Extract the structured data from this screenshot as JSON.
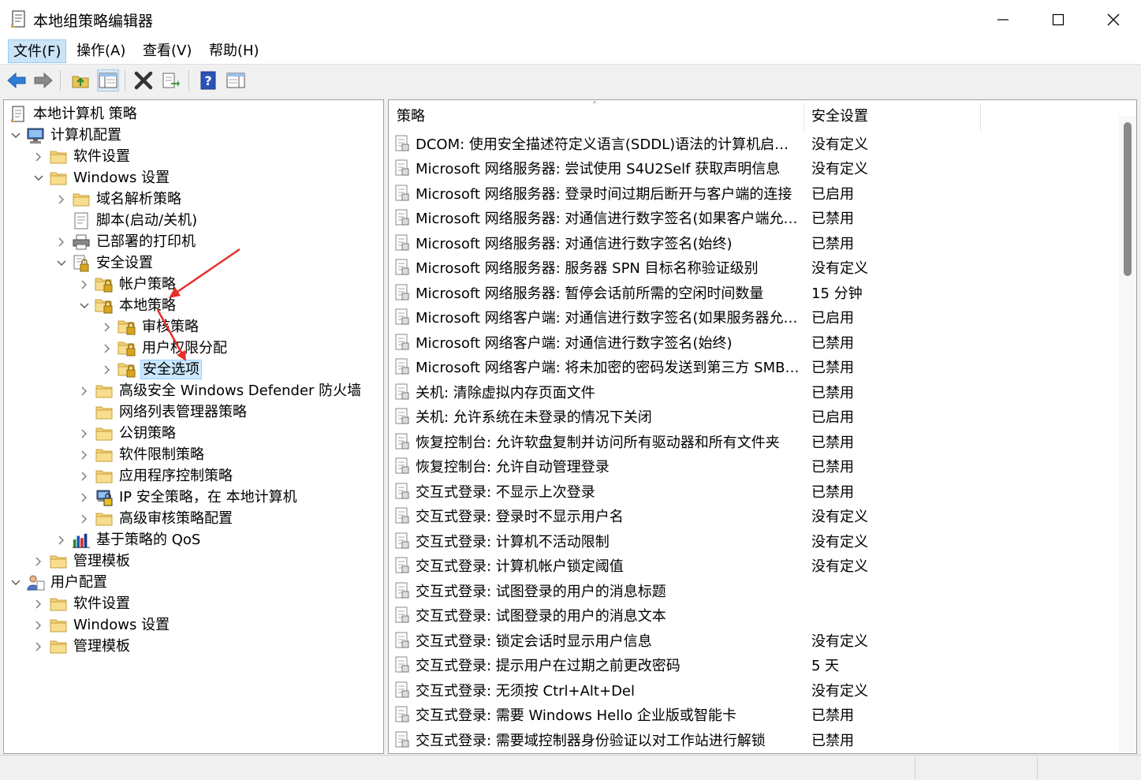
{
  "window": {
    "title": "本地组策略编辑器"
  },
  "menu": [
    {
      "label": "文件(F)",
      "active": true
    },
    {
      "label": "操作(A)",
      "active": false
    },
    {
      "label": "查看(V)",
      "active": false
    },
    {
      "label": "帮助(H)",
      "active": false
    }
  ],
  "tree": {
    "root": "本地计算机 策略",
    "items": [
      {
        "label": "计算机配置",
        "level": 1,
        "chev": "down",
        "icon": "computer-icon"
      },
      {
        "label": "软件设置",
        "level": 2,
        "chev": "right",
        "icon": "folder-icon"
      },
      {
        "label": "Windows 设置",
        "level": 2,
        "chev": "down",
        "icon": "folder-icon"
      },
      {
        "label": "域名解析策略",
        "level": 3,
        "chev": "right",
        "icon": "folder-icon"
      },
      {
        "label": "脚本(启动/关机)",
        "level": 3,
        "chev": "none",
        "icon": "script-icon"
      },
      {
        "label": "已部署的打印机",
        "level": 3,
        "chev": "right",
        "icon": "printer-icon"
      },
      {
        "label": "安全设置",
        "level": 3,
        "chev": "down",
        "icon": "security-settings-icon"
      },
      {
        "label": "帐户策略",
        "level": 4,
        "chev": "right",
        "icon": "secure-folder-icon"
      },
      {
        "label": "本地策略",
        "level": 4,
        "chev": "down",
        "icon": "secure-folder-icon"
      },
      {
        "label": "审核策略",
        "level": 5,
        "chev": "right",
        "icon": "secure-folder-icon"
      },
      {
        "label": "用户权限分配",
        "level": 5,
        "chev": "right",
        "icon": "secure-folder-icon"
      },
      {
        "label": "安全选项",
        "level": 5,
        "chev": "right",
        "icon": "secure-folder-icon",
        "selected": true
      },
      {
        "label": "高级安全 Windows Defender 防火墙",
        "level": 4,
        "chev": "right",
        "icon": "folder-icon"
      },
      {
        "label": "网络列表管理器策略",
        "level": 4,
        "chev": "none",
        "icon": "folder-icon"
      },
      {
        "label": "公钥策略",
        "level": 4,
        "chev": "right",
        "icon": "folder-icon"
      },
      {
        "label": "软件限制策略",
        "level": 4,
        "chev": "right",
        "icon": "folder-icon"
      },
      {
        "label": "应用程序控制策略",
        "level": 4,
        "chev": "right",
        "icon": "folder-icon"
      },
      {
        "label": "IP 安全策略，在 本地计算机",
        "level": 4,
        "chev": "right",
        "icon": "ip-security-icon"
      },
      {
        "label": "高级审核策略配置",
        "level": 4,
        "chev": "right",
        "icon": "folder-icon"
      },
      {
        "label": "基于策略的 QoS",
        "level": 3,
        "chev": "right",
        "icon": "qos-chart-icon"
      },
      {
        "label": "管理模板",
        "level": 2,
        "chev": "right",
        "icon": "folder-icon"
      },
      {
        "label": "用户配置",
        "level": 1,
        "chev": "down",
        "icon": "user-icon"
      },
      {
        "label": "软件设置",
        "level": 2,
        "chev": "right",
        "icon": "folder-icon"
      },
      {
        "label": "Windows 设置",
        "level": 2,
        "chev": "right",
        "icon": "folder-icon"
      },
      {
        "label": "管理模板",
        "level": 2,
        "chev": "right",
        "icon": "folder-icon"
      }
    ]
  },
  "list": {
    "columns": {
      "policy": "策略",
      "setting": "安全设置"
    },
    "rows": [
      {
        "name": "DCOM: 使用安全描述符定义语言(SDDL)语法的计算机启动...",
        "value": "没有定义"
      },
      {
        "name": "Microsoft 网络服务器: 尝试使用 S4U2Self 获取声明信息",
        "value": "没有定义"
      },
      {
        "name": "Microsoft 网络服务器: 登录时间过期后断开与客户端的连接",
        "value": "已启用"
      },
      {
        "name": "Microsoft 网络服务器: 对通信进行数字签名(如果客户端允许)",
        "value": "已禁用"
      },
      {
        "name": "Microsoft 网络服务器: 对通信进行数字签名(始终)",
        "value": "已禁用"
      },
      {
        "name": "Microsoft 网络服务器: 服务器 SPN 目标名称验证级别",
        "value": "没有定义"
      },
      {
        "name": "Microsoft 网络服务器: 暂停会话前所需的空闲时间数量",
        "value": "15 分钟"
      },
      {
        "name": "Microsoft 网络客户端: 对通信进行数字签名(如果服务器允许)",
        "value": "已启用"
      },
      {
        "name": "Microsoft 网络客户端: 对通信进行数字签名(始终)",
        "value": "已禁用"
      },
      {
        "name": "Microsoft 网络客户端: 将未加密的密码发送到第三方 SMB ...",
        "value": "已禁用"
      },
      {
        "name": "关机: 清除虚拟内存页面文件",
        "value": "已禁用"
      },
      {
        "name": "关机: 允许系统在未登录的情况下关闭",
        "value": "已启用"
      },
      {
        "name": "恢复控制台: 允许软盘复制并访问所有驱动器和所有文件夹",
        "value": "已禁用"
      },
      {
        "name": "恢复控制台: 允许自动管理登录",
        "value": "已禁用"
      },
      {
        "name": "交互式登录: 不显示上次登录",
        "value": "已禁用"
      },
      {
        "name": "交互式登录: 登录时不显示用户名",
        "value": "没有定义"
      },
      {
        "name": "交互式登录: 计算机不活动限制",
        "value": "没有定义"
      },
      {
        "name": "交互式登录: 计算机帐户锁定阈值",
        "value": "没有定义"
      },
      {
        "name": "交互式登录: 试图登录的用户的消息标题",
        "value": ""
      },
      {
        "name": "交互式登录: 试图登录的用户的消息文本",
        "value": ""
      },
      {
        "name": "交互式登录: 锁定会话时显示用户信息",
        "value": "没有定义"
      },
      {
        "name": "交互式登录: 提示用户在过期之前更改密码",
        "value": "5 天"
      },
      {
        "name": "交互式登录: 无须按 Ctrl+Alt+Del",
        "value": "没有定义"
      },
      {
        "name": "交互式登录: 需要 Windows Hello 企业版或智能卡",
        "value": "已禁用"
      },
      {
        "name": "交互式登录: 需要域控制器身份验证以对工作站进行解锁",
        "value": "已禁用"
      }
    ]
  },
  "colors": {
    "selection": "#cce8ff",
    "menu_active": "#cce4f7",
    "annotation_arrow": "#e8302a"
  }
}
